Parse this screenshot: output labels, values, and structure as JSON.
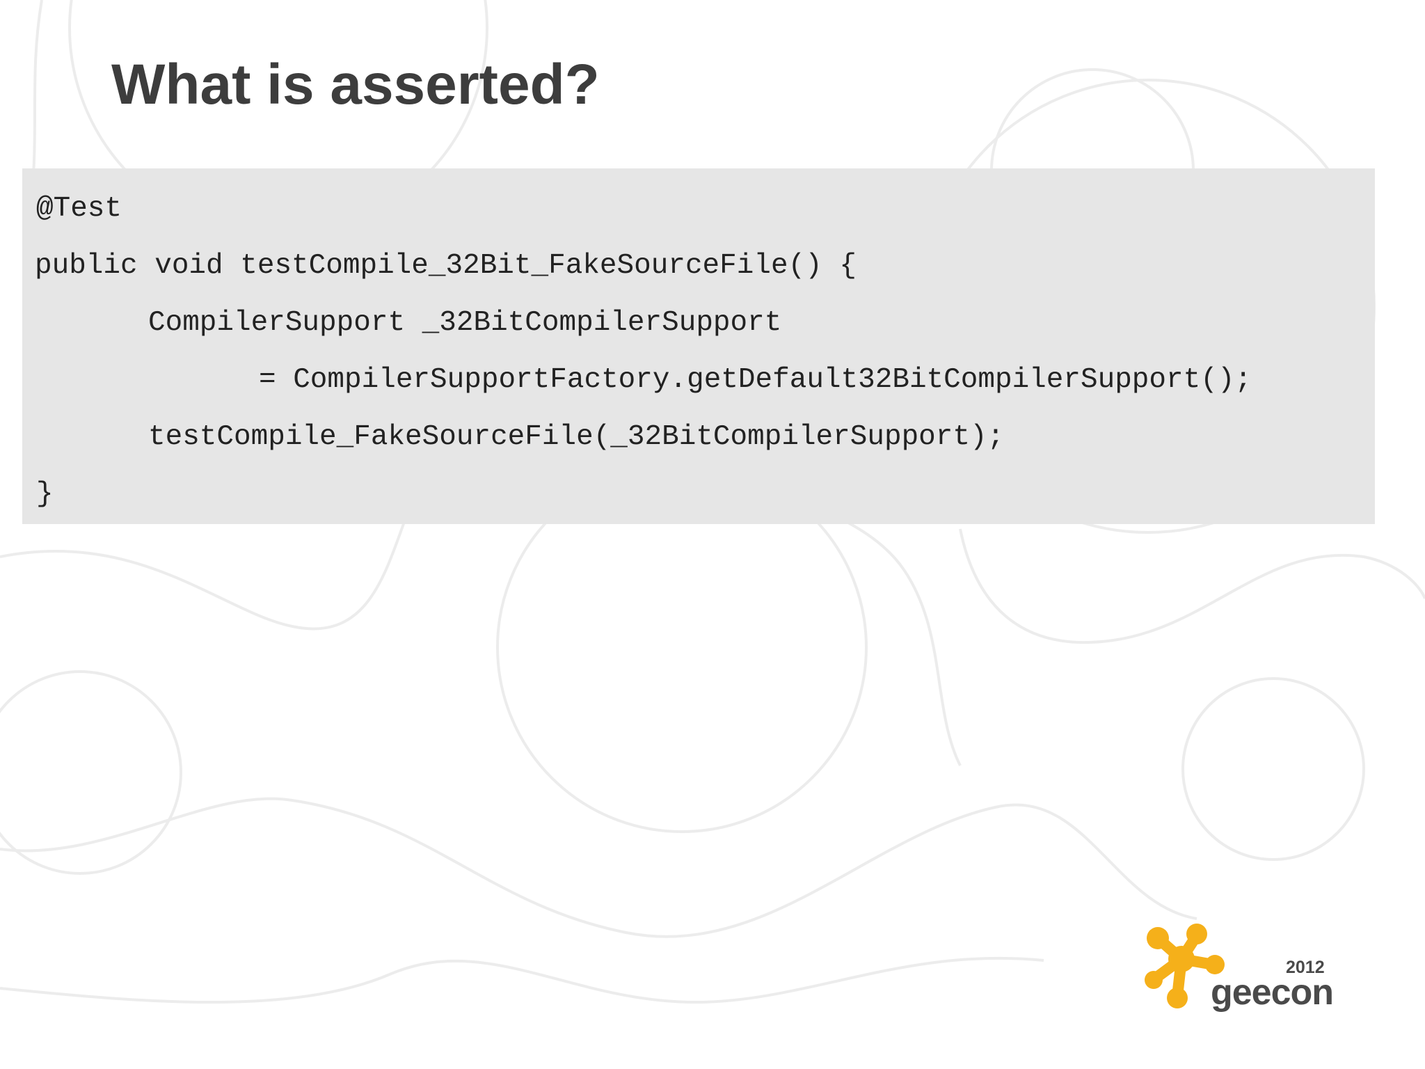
{
  "slide": {
    "title": "What is asserted?"
  },
  "code": {
    "lines": [
      "@Test",
      "public void testCompile_32Bit_FakeSourceFile() {",
      "CompilerSupport _32BitCompilerSupport",
      "= CompilerSupportFactory.getDefault32BitCompilerSupport();",
      "testCompile_FakeSourceFile(_32BitCompilerSupport);",
      "}"
    ]
  },
  "logo": {
    "year": "2012",
    "name": "geecon"
  },
  "colors": {
    "title": "#3d3d3d",
    "code_background": "#e6e6e6",
    "code_text": "#222222",
    "logo_accent": "#f5b01a",
    "background_pattern": "#ececec"
  }
}
